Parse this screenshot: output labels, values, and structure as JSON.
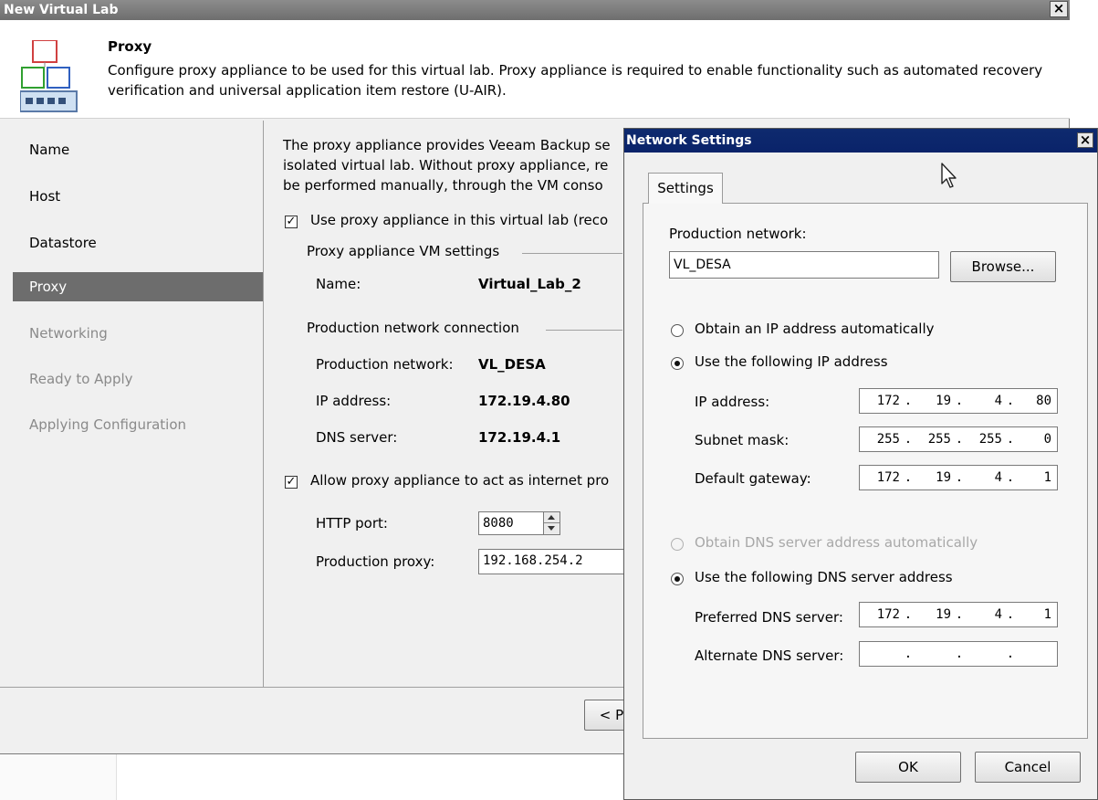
{
  "wizard": {
    "title": "New Virtual Lab",
    "header": {
      "title": "Proxy",
      "description": "Configure proxy appliance to be used for this virtual lab. Proxy appliance is required to enable functionality such as automated recovery verification and universal application item restore (U-AIR)."
    },
    "nav": [
      {
        "label": "Name",
        "state": "normal"
      },
      {
        "label": "Host",
        "state": "normal"
      },
      {
        "label": "Datastore",
        "state": "normal"
      },
      {
        "label": "Proxy",
        "state": "active"
      },
      {
        "label": "Networking",
        "state": "disabled"
      },
      {
        "label": "Ready to Apply",
        "state": "disabled"
      },
      {
        "label": "Applying Configuration",
        "state": "disabled"
      }
    ],
    "content": {
      "intro_lines": [
        "The proxy appliance provides Veeam Backup se",
        "isolated virtual lab. Without proxy appliance, re",
        "be performed manually, through the VM conso"
      ],
      "use_proxy_label": "Use proxy appliance in this virtual lab (reco",
      "use_proxy_checked": true,
      "vm_settings_group": "Proxy appliance VM settings",
      "name_label": "Name:",
      "name_value": "Virtual_Lab_2",
      "prod_conn_group": "Production network connection",
      "prod_network_label": "Production network:",
      "prod_network_value": "VL_DESA",
      "ip_label": "IP address:",
      "ip_value": "172.19.4.80",
      "dns_label": "DNS server:",
      "dns_value": "172.19.4.1",
      "allow_proxy_label": "Allow proxy appliance to act as internet pro",
      "allow_proxy_checked": true,
      "http_port_label": "HTTP port:",
      "http_port_value": "8080",
      "prod_proxy_label": "Production proxy:",
      "prod_proxy_value": "192.168.254.2"
    },
    "footer": {
      "prev_label": "< P"
    }
  },
  "network_dialog": {
    "title": "Network Settings",
    "tab_label": "Settings",
    "prod_network_label": "Production network:",
    "prod_network_value": "VL_DESA",
    "browse_label": "Browse...",
    "obtain_ip_auto_label": "Obtain an IP address automatically",
    "use_following_ip_label": "Use the following IP address",
    "ip_address_label": "IP address:",
    "ip_address": [
      "172",
      "19",
      "4",
      "80"
    ],
    "subnet_label": "Subnet mask:",
    "subnet": [
      "255",
      "255",
      "255",
      "0"
    ],
    "gateway_label": "Default gateway:",
    "gateway": [
      "172",
      "19",
      "4",
      "1"
    ],
    "obtain_dns_auto_label": "Obtain DNS server address automatically",
    "use_following_dns_label": "Use the following DNS server address",
    "preferred_dns_label": "Preferred DNS server:",
    "preferred_dns": [
      "172",
      "19",
      "4",
      "1"
    ],
    "alternate_dns_label": "Alternate DNS server:",
    "alternate_dns": [
      "",
      "",
      "",
      ""
    ],
    "ok_label": "OK",
    "cancel_label": "Cancel",
    "selected_ip_mode": "manual",
    "selected_dns_mode": "manual"
  },
  "colors": {
    "dialog_titlebar": "#0a236a",
    "wizard_titlebar": "#7a7a7a",
    "nav_active": "#6d6d6d"
  },
  "icons": {
    "header_icon": "virtual-lab-icon",
    "close": "close-icon",
    "cursor": "mouse-pointer-icon"
  }
}
